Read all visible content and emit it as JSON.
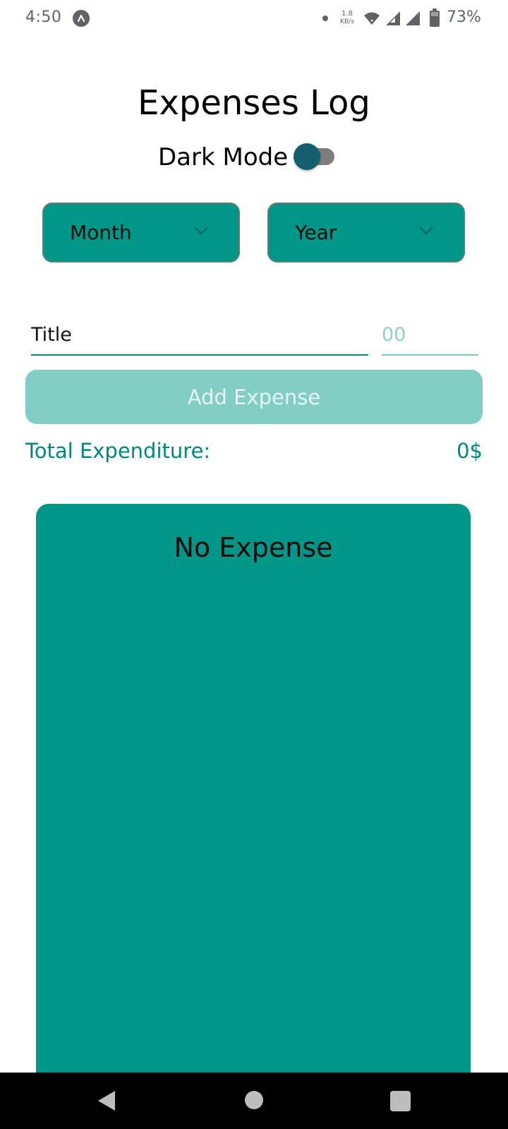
{
  "status_bar": {
    "time": "4:50",
    "network_speed_value": "1.8",
    "network_speed_unit": "KB/s",
    "battery_percent": "73%",
    "icons": [
      "app-notification-icon",
      "wifi-icon",
      "signal-icon",
      "signal-icon",
      "battery-icon"
    ]
  },
  "header": {
    "title": "Expenses Log",
    "dark_mode_label": "Dark Mode",
    "dark_mode_enabled": false
  },
  "filters": {
    "month": {
      "label": "Month",
      "icon": "chevron-down-icon"
    },
    "year": {
      "label": "Year",
      "icon": "chevron-down-icon"
    }
  },
  "form": {
    "title_placeholder": "Title",
    "amount_placeholder": "00",
    "add_button_label": "Add Expense"
  },
  "summary": {
    "total_label": "Total Expenditure:",
    "total_value": "0$"
  },
  "expenses": {
    "empty_text": "No Expense",
    "items": []
  },
  "colors": {
    "accent": "#009688",
    "accent_dark": "#00897b",
    "button_disabled": "#82cdc4",
    "toggle_thumb": "#135f70"
  },
  "nav_bar": {
    "icons": [
      "back-icon",
      "home-icon",
      "recents-icon"
    ]
  }
}
